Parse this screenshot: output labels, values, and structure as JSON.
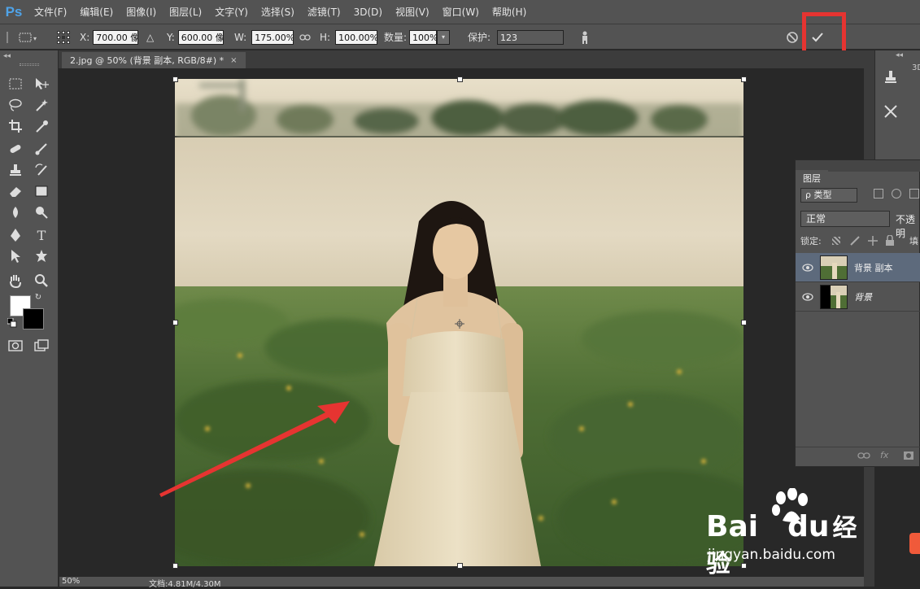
{
  "app": {
    "logo": "Ps"
  },
  "menu": [
    "文件(F)",
    "编辑(E)",
    "图像(I)",
    "图层(L)",
    "文字(Y)",
    "选择(S)",
    "滤镜(T)",
    "3D(D)",
    "视图(V)",
    "窗口(W)",
    "帮助(H)"
  ],
  "options": {
    "x_label": "X:",
    "x_value": "700.00 像",
    "delta_label": "△",
    "y_label": "Y:",
    "y_value": "600.00 像",
    "w_label": "W:",
    "w_value": "175.00%",
    "h_label": "H:",
    "h_value": "100.00%",
    "amount_label": "数量:",
    "amount_value": "100%",
    "protect_label": "保护:",
    "protect_value": "123",
    "cancel_icon": "cancel-icon",
    "commit_icon": "checkmark-icon"
  },
  "document": {
    "tab_title": "2.jpg @ 50% (背景 副本, RGB/8#) *",
    "close": "×"
  },
  "status": {
    "zoom": "50%",
    "doc_info": "文档:4.81M/4.30M"
  },
  "layers": {
    "tab": "图层",
    "filter_label": "ρ 类型",
    "blend_mode": "正常",
    "opacity_label": "不透明",
    "lock_label": "锁定:",
    "fill_short": "填",
    "items": [
      {
        "name": "背景 副本",
        "selected": true,
        "italic": false
      },
      {
        "name": "背景",
        "selected": false,
        "italic": true
      }
    ]
  },
  "right_dock": {
    "label_3d": "3D"
  },
  "watermark": {
    "text_bai": "Bai",
    "text_du": "du",
    "text_jy": "经验",
    "url": "jingyan.baidu.com"
  },
  "colors": {
    "accent_red": "#e63431",
    "chrome": "#535353",
    "canvas_bg": "#282828",
    "fg": "#ffffff",
    "bg": "#000000"
  }
}
